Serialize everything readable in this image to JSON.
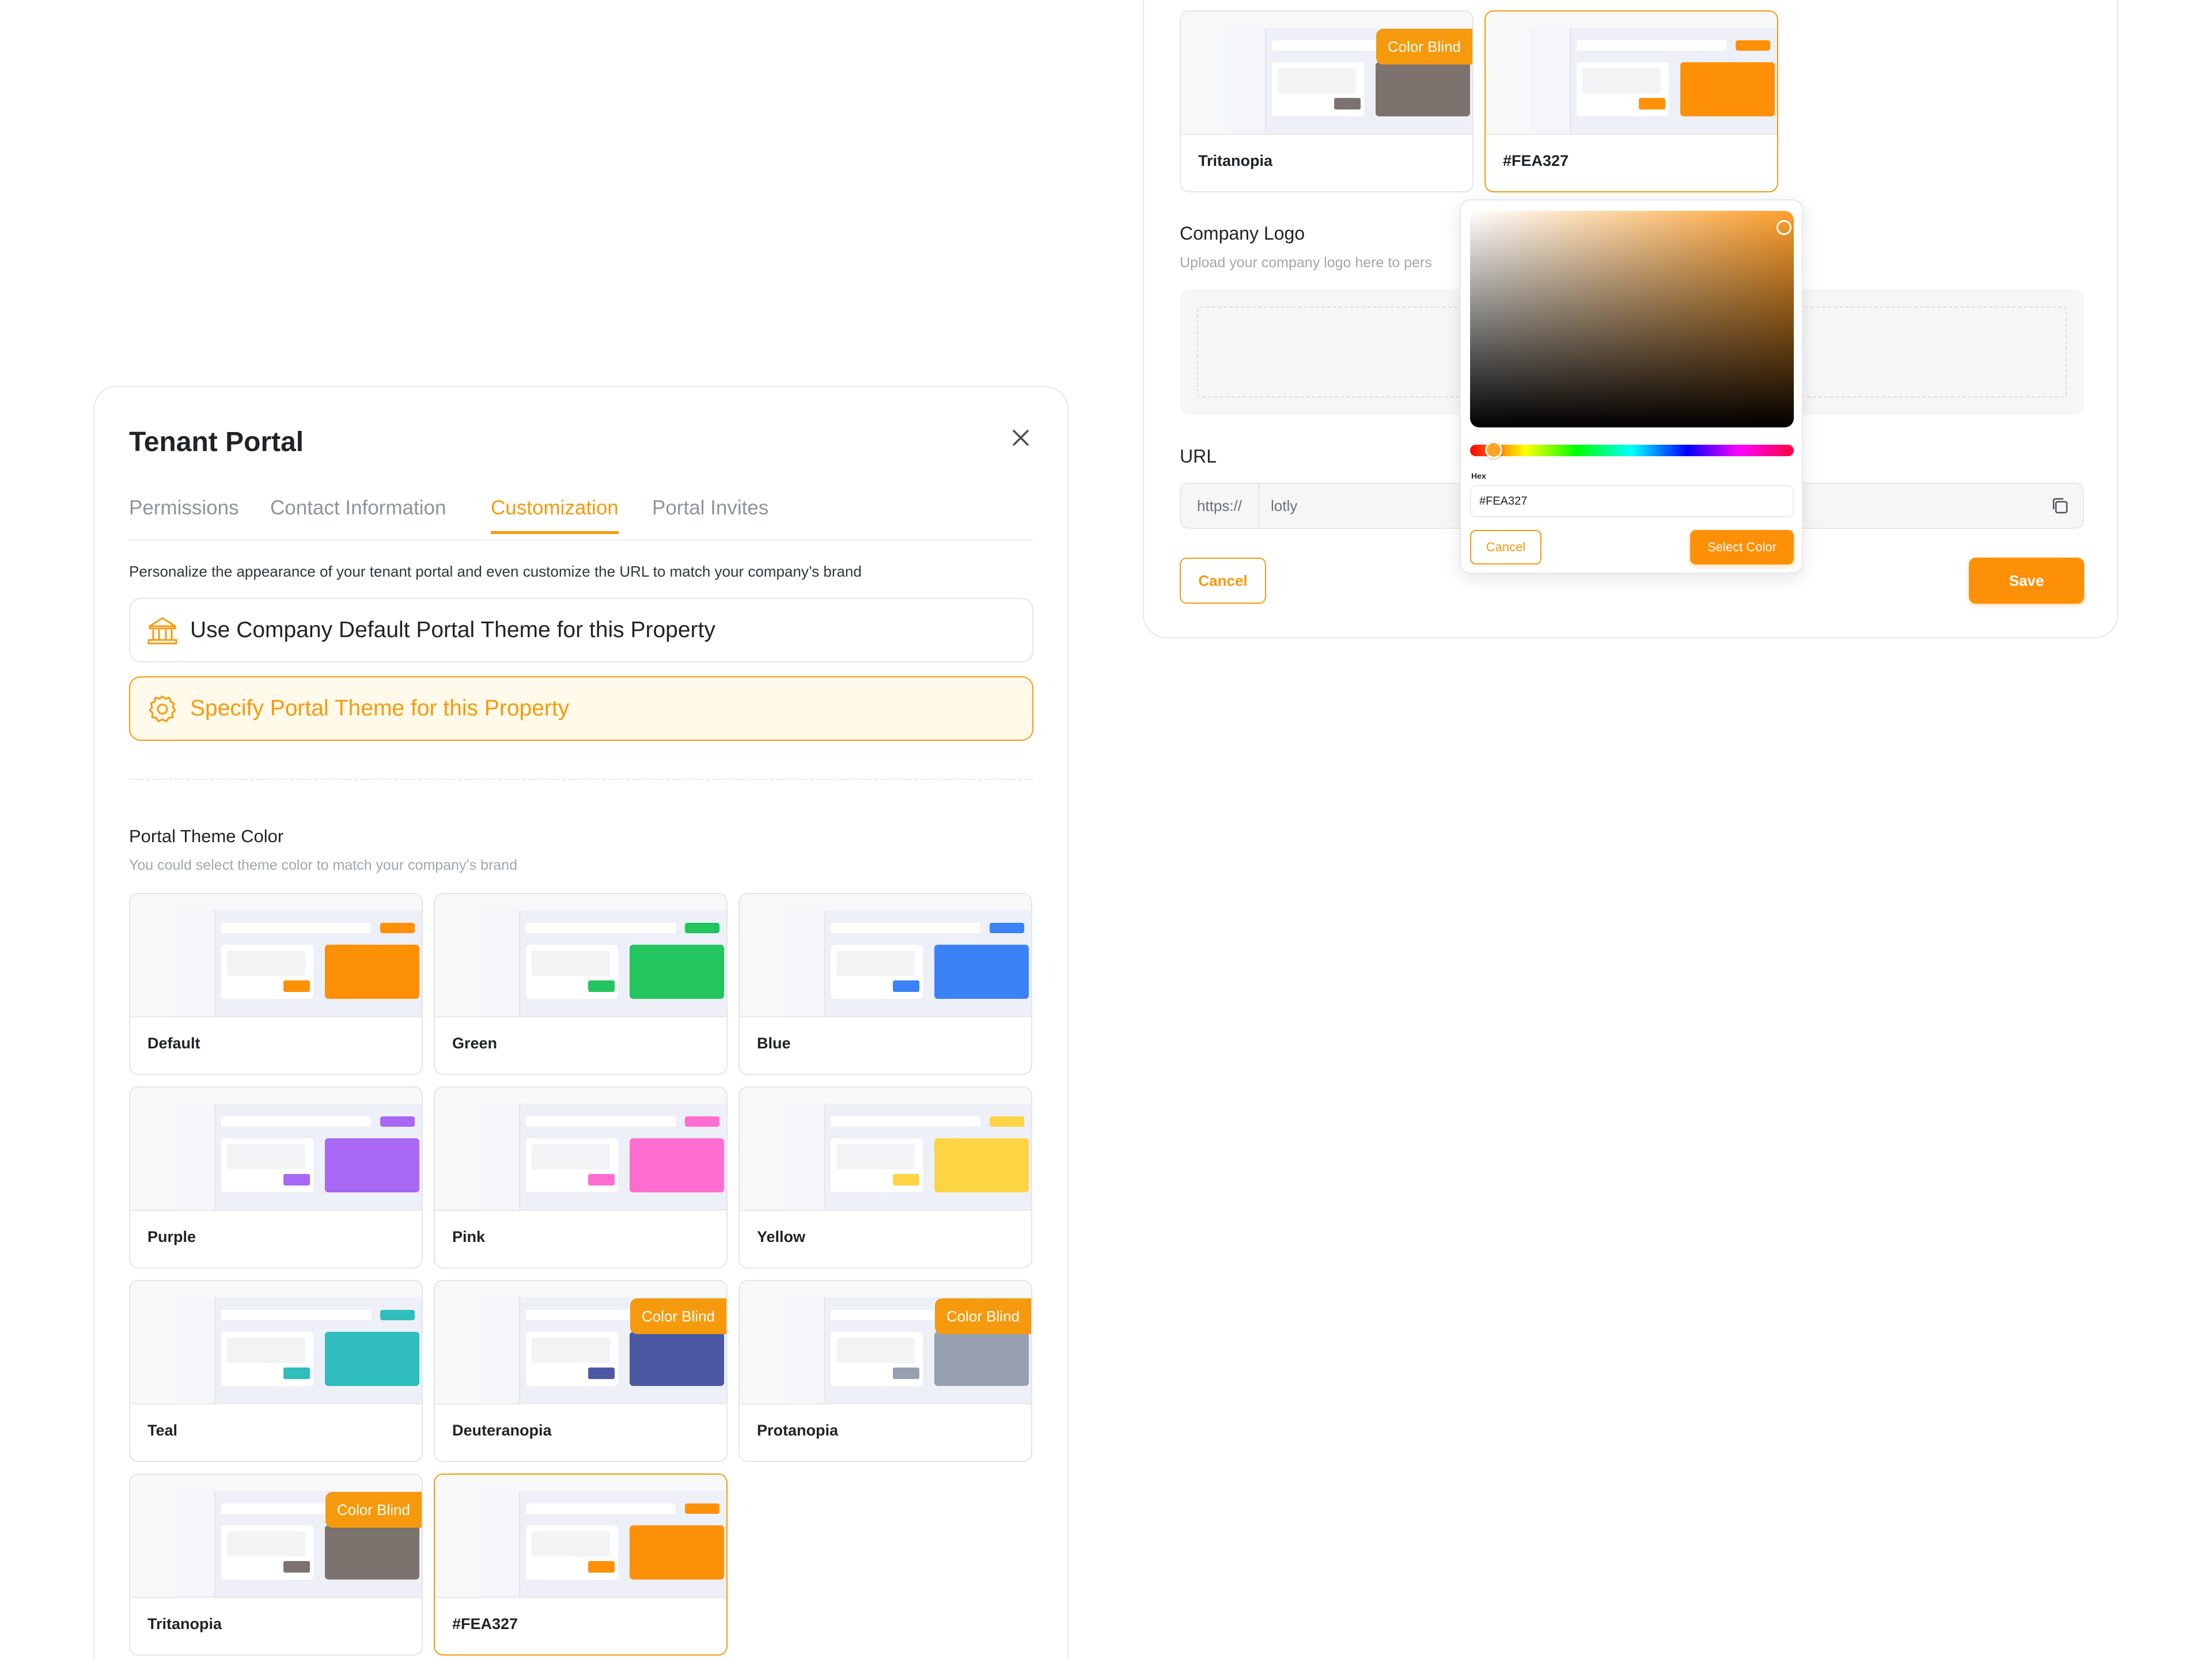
{
  "modal": {
    "title": "Tenant Portal",
    "tabs": [
      {
        "label": "Permissions",
        "active": false
      },
      {
        "label": "Contact Information",
        "active": false
      },
      {
        "label": "Customization",
        "active": true
      },
      {
        "label": "Portal Invites",
        "active": false
      }
    ],
    "intro": "Personalize the appearance of your tenant portal and even customize the URL to match your company’s brand",
    "options": [
      {
        "label": "Use Company Default Portal Theme for this Property",
        "icon": "building-icon",
        "selected": false
      },
      {
        "label": "Specify Portal Theme for this Property",
        "icon": "gear-icon",
        "selected": true
      }
    ],
    "theme_section": {
      "title": "Portal Theme Color",
      "subtitle": "You could select theme color to match your company’s brand"
    },
    "themes": [
      {
        "label": "Default",
        "color": "#FE9007",
        "badge": ""
      },
      {
        "label": "Green",
        "color": "#22C55E",
        "badge": ""
      },
      {
        "label": "Blue",
        "color": "#3B82F6",
        "badge": ""
      },
      {
        "label": "Purple",
        "color": "#A968F4",
        "badge": ""
      },
      {
        "label": "Pink",
        "color": "#FF6DD1",
        "badge": ""
      },
      {
        "label": "Yellow",
        "color": "#FDD444",
        "badge": ""
      },
      {
        "label": "Teal",
        "color": "#2FBDBD",
        "badge": ""
      },
      {
        "label": "Deuteranopia",
        "color": "#4C58A4",
        "badge": "Color Blind"
      },
      {
        "label": "Protanopia",
        "color": "#96A0B0",
        "badge": "Color Blind"
      },
      {
        "label": "Tritanopia",
        "color": "#7C726E",
        "badge": "Color Blind"
      },
      {
        "label": "#FEA327",
        "color": "#FE9007",
        "badge": "",
        "selected": true
      }
    ]
  },
  "right_panel": {
    "themes": [
      {
        "label": "Tritanopia",
        "color": "#7C726E",
        "badge": "Color Blind"
      },
      {
        "label": "#FEA327",
        "color": "#FE9007",
        "badge": "",
        "selected": true
      }
    ],
    "logo": {
      "title": "Company Logo",
      "subtitle": "Upload your company logo here to pers"
    },
    "url": {
      "label": "URL",
      "prefix": "https://",
      "value": "lotly"
    },
    "cancel_label": "Cancel",
    "save_label": "Save"
  },
  "color_picker": {
    "hex_label": "Hex",
    "hex_value": "#FEA327",
    "cancel_label": "Cancel",
    "select_label": "Select Color",
    "selected_color": "#FEA327"
  }
}
